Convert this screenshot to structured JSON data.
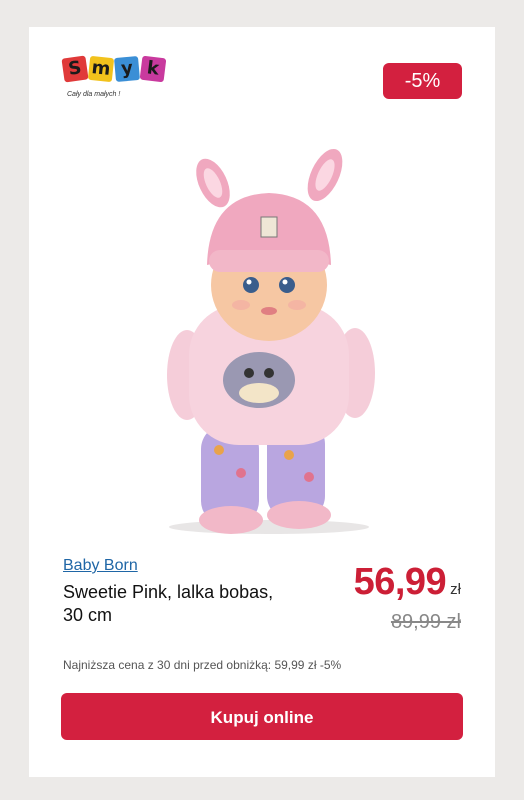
{
  "logo": {
    "letters": [
      "S",
      "m",
      "y",
      "k"
    ],
    "slogan": "Cały dla małych !"
  },
  "discount_badge": "-5%",
  "product": {
    "brand": "Baby Born",
    "title": "Sweetie Pink, lalka bobas, 30 cm",
    "price": "56,99",
    "currency": "zł",
    "old_price": "89,99 zł"
  },
  "lowest_price_note": "Najniższa cena z 30 dni przed obniżką: 59,99 zł -5%",
  "cta_label": "Kupuj online",
  "colors": {
    "accent": "#d3203f",
    "link": "#1f66a6",
    "page_bg": "#eceae8",
    "logo_tiles": [
      "#e03a3a",
      "#f2c21c",
      "#3b8fd6",
      "#c93a9e"
    ]
  }
}
